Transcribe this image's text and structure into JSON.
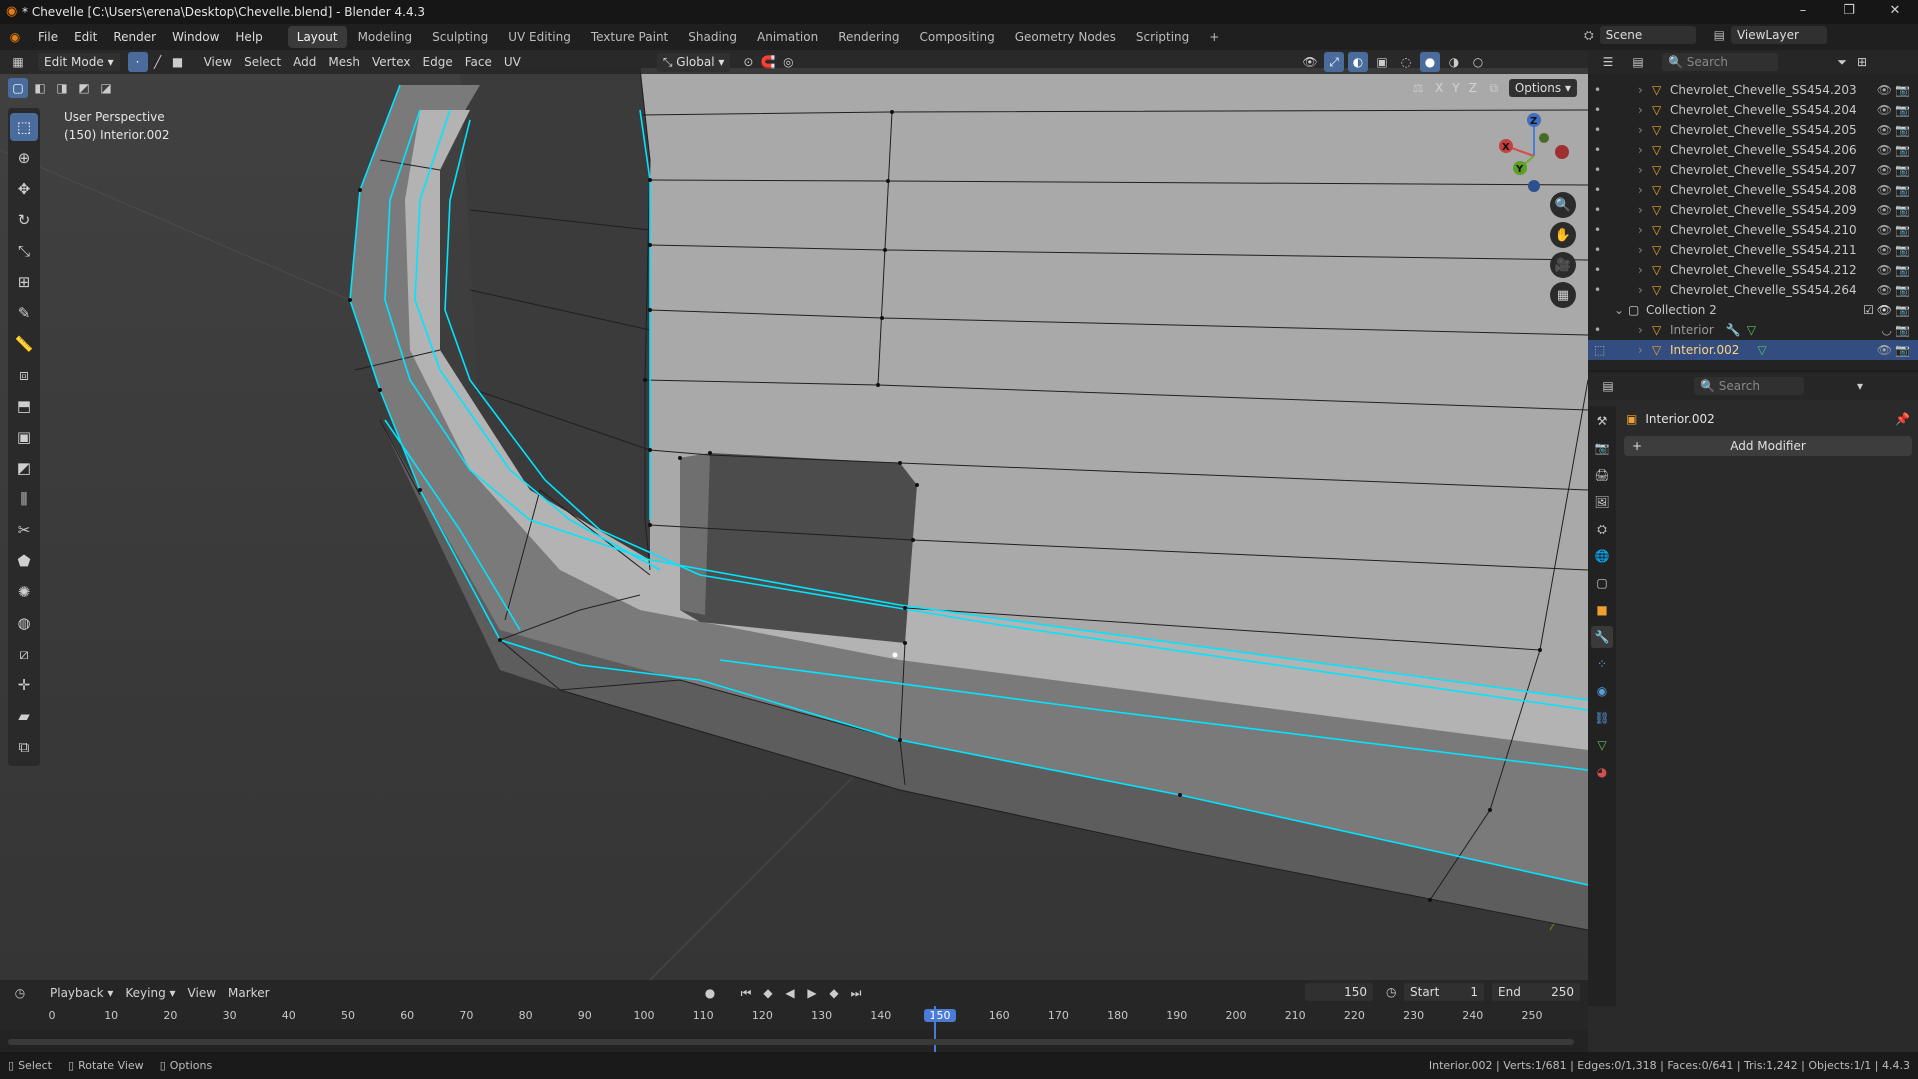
{
  "window": {
    "title": "* Chevelle [C:\\Users\\erena\\Desktop\\Chevelle.blend] - Blender 4.4.3",
    "minimize": "–",
    "maximize": "❐",
    "close": "✕"
  },
  "menu": [
    "File",
    "Edit",
    "Render",
    "Window",
    "Help"
  ],
  "workspaces": [
    "Layout",
    "Modeling",
    "Sculpting",
    "UV Editing",
    "Texture Paint",
    "Shading",
    "Animation",
    "Rendering",
    "Compositing",
    "Geometry Nodes",
    "Scripting"
  ],
  "workspace_add": "+",
  "scene": {
    "name": "Scene",
    "viewlayer": "ViewLayer"
  },
  "viewport_header": {
    "mode": "Edit Mode",
    "menus": [
      "View",
      "Select",
      "Add",
      "Mesh",
      "Vertex",
      "Edge",
      "Face",
      "UV"
    ],
    "orientation": "Global",
    "options": "Options",
    "axes": [
      "X",
      "Y",
      "Z"
    ]
  },
  "viewport": {
    "perspective": "User Perspective",
    "object_info": "(150) Interior.002"
  },
  "gizmo": {
    "z": "Z",
    "x": "X",
    "y": "Y"
  },
  "outliner": {
    "search_placeholder": "Search",
    "items": [
      "Chevrolet_Chevelle_SS454.203",
      "Chevrolet_Chevelle_SS454.204",
      "Chevrolet_Chevelle_SS454.205",
      "Chevrolet_Chevelle_SS454.206",
      "Chevrolet_Chevelle_SS454.207",
      "Chevrolet_Chevelle_SS454.208",
      "Chevrolet_Chevelle_SS454.209",
      "Chevrolet_Chevelle_SS454.210",
      "Chevrolet_Chevelle_SS454.211",
      "Chevrolet_Chevelle_SS454.212",
      "Chevrolet_Chevelle_SS454.264"
    ],
    "collection": "Collection 2",
    "children": [
      "Interior",
      "Interior.002"
    ]
  },
  "properties": {
    "search_placeholder": "Search",
    "object_name": "Interior.002",
    "add_modifier": "Add Modifier"
  },
  "timeline": {
    "menus": [
      "Playback",
      "Keying",
      "View",
      "Marker"
    ],
    "current_frame": "150",
    "start_label": "Start",
    "start": "1",
    "end_label": "End",
    "end": "250",
    "ticks": [
      "0",
      "10",
      "20",
      "30",
      "40",
      "50",
      "60",
      "70",
      "80",
      "90",
      "100",
      "110",
      "120",
      "130",
      "140",
      "150",
      "160",
      "170",
      "180",
      "190",
      "200",
      "210",
      "220",
      "230",
      "240",
      "250"
    ]
  },
  "status": {
    "select": "Select",
    "rotate": "Rotate View",
    "options": "Options",
    "stats": "Interior.002 | Verts:1/681 | Edges:0/1,318 | Faces:0/641 | Tris:1,242 | Objects:1/1 | 4.4.3"
  },
  "colors": {
    "accent": "#4a6c9c",
    "edge_select": "#00e5ff",
    "selected_row": "#334d80"
  }
}
